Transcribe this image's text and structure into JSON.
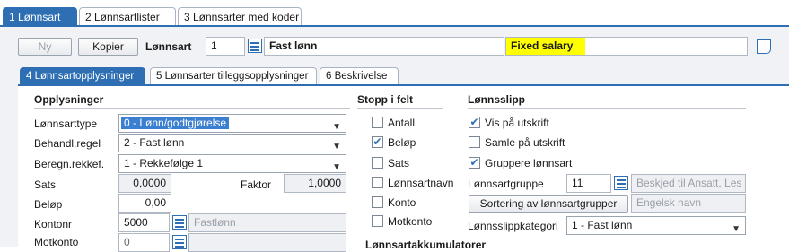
{
  "top_tabs": [
    {
      "label": "1 Lønnsart"
    },
    {
      "label": "2 Lønnsartlister"
    },
    {
      "label": "3 Lønnsarter med koder"
    }
  ],
  "header": {
    "ny_label": "Ny",
    "kopier_label": "Kopier",
    "lonnsart_label": "Lønnsart",
    "lonnsart_number": "1",
    "lonnsart_name": "Fast lønn",
    "lonnsart_name_en": "Fixed salary",
    "highlight_color": "#ffff00"
  },
  "sub_tabs": [
    {
      "label": "4 Lønnsartopplysninger"
    },
    {
      "label": "5 Lønnsarter tilleggsopplysninger"
    },
    {
      "label": "6 Beskrivelse"
    }
  ],
  "opplysninger": {
    "title": "Opplysninger",
    "lonnsarttype_label": "Lønnsarttype",
    "lonnsarttype_value": "0 - Lønn/godtgjørelse",
    "behandl_label": "Behandl.regel",
    "behandl_value": "2 - Fast lønn",
    "beregn_label": "Beregn.rekkef.",
    "beregn_value": "1 - Rekkefølge 1",
    "sats_label": "Sats",
    "sats_value": "0,0000",
    "faktor_label": "Faktor",
    "faktor_value": "1,0000",
    "belop_label": "Beløp",
    "belop_value": "0,00",
    "kontonr_label": "Kontonr",
    "kontonr_value": "5000",
    "kontonr_name": "Fastlønn",
    "motkonto_label": "Motkonto",
    "motkonto_value": "0"
  },
  "stopp": {
    "title": "Stopp i felt",
    "items": [
      {
        "label": "Antall",
        "checked": false
      },
      {
        "label": "Beløp",
        "checked": true
      },
      {
        "label": "Sats",
        "checked": false
      },
      {
        "label": "Lønnsartnavn",
        "checked": false
      },
      {
        "label": "Konto",
        "checked": false
      },
      {
        "label": "Motkonto",
        "checked": false
      }
    ]
  },
  "lonnsslipp": {
    "title": "Lønnsslipp",
    "items": [
      {
        "label": "Vis på utskrift",
        "checked": true
      },
      {
        "label": "Samle på utskrift",
        "checked": false
      },
      {
        "label": "Gruppere lønnsart",
        "checked": true
      }
    ],
    "gruppe_label": "Lønnsartgruppe",
    "gruppe_value": "11",
    "gruppe_desc": "Beskjed til Ansatt, Les",
    "sortering_label": "Sortering av lønnsartgrupper",
    "engelsk_placeholder": "Engelsk navn",
    "kategori_label": "Lønnsslippkategori",
    "kategori_value": "1 - Fast lønn"
  },
  "bottom_section_title": "Lønnsartakkumulatorer"
}
